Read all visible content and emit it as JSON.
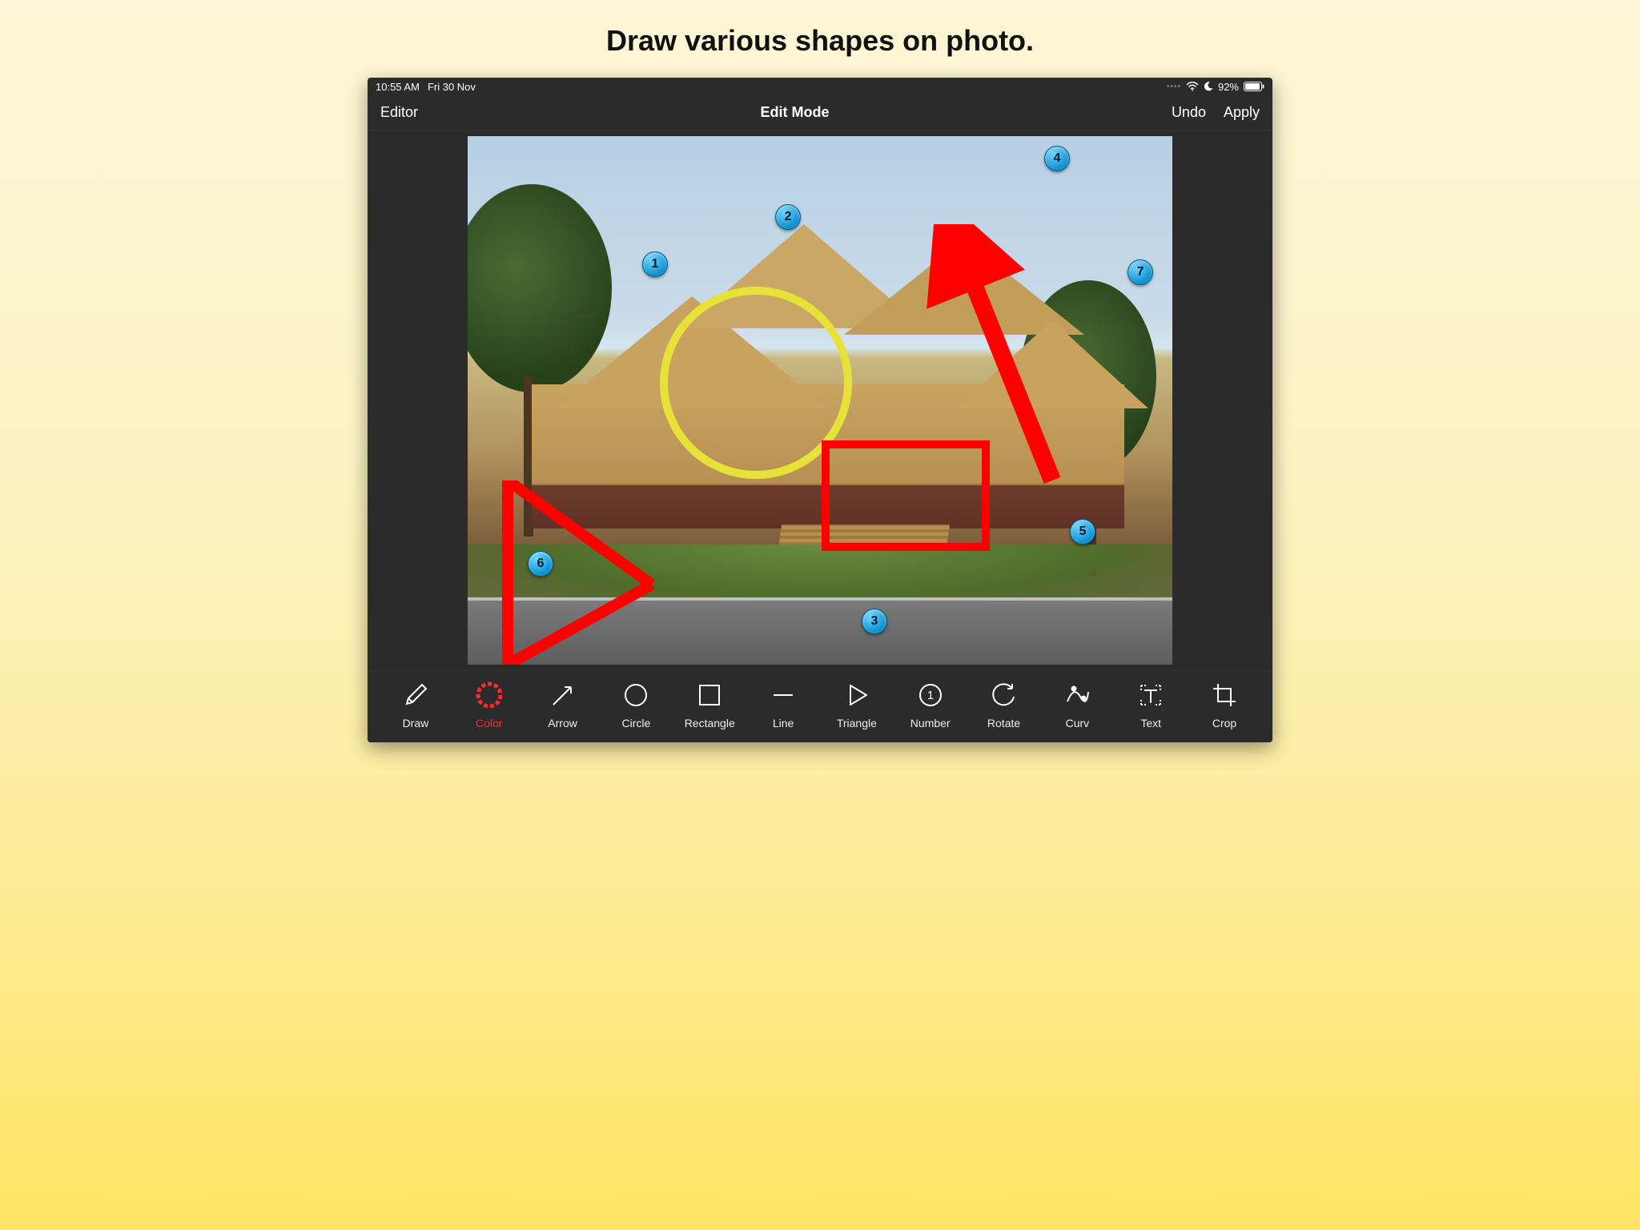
{
  "page": {
    "title": "Draw various shapes on photo."
  },
  "status": {
    "time": "10:55 AM",
    "date": "Fri 30 Nov",
    "battery_pct": "92%"
  },
  "nav": {
    "left_label": "Editor",
    "center_label": "Edit Mode",
    "undo_label": "Undo",
    "apply_label": "Apply"
  },
  "pins": {
    "p1": "1",
    "p2": "2",
    "p3": "3",
    "p4": "4",
    "p5": "5",
    "p6": "6",
    "p7": "7"
  },
  "tools": {
    "draw": "Draw",
    "color": "Color",
    "arrow": "Arrow",
    "circle": "Circle",
    "rectangle": "Rectangle",
    "line": "Line",
    "triangle": "Triangle",
    "number": "Number",
    "rotate": "Rotate",
    "curv": "Curv",
    "text": "Text",
    "crop": "Crop"
  },
  "colors": {
    "accent": "#ff2a2a",
    "pin": "#0a8fcf",
    "circle_stroke": "#e7e23a",
    "shape_stroke": "#ff0000"
  }
}
